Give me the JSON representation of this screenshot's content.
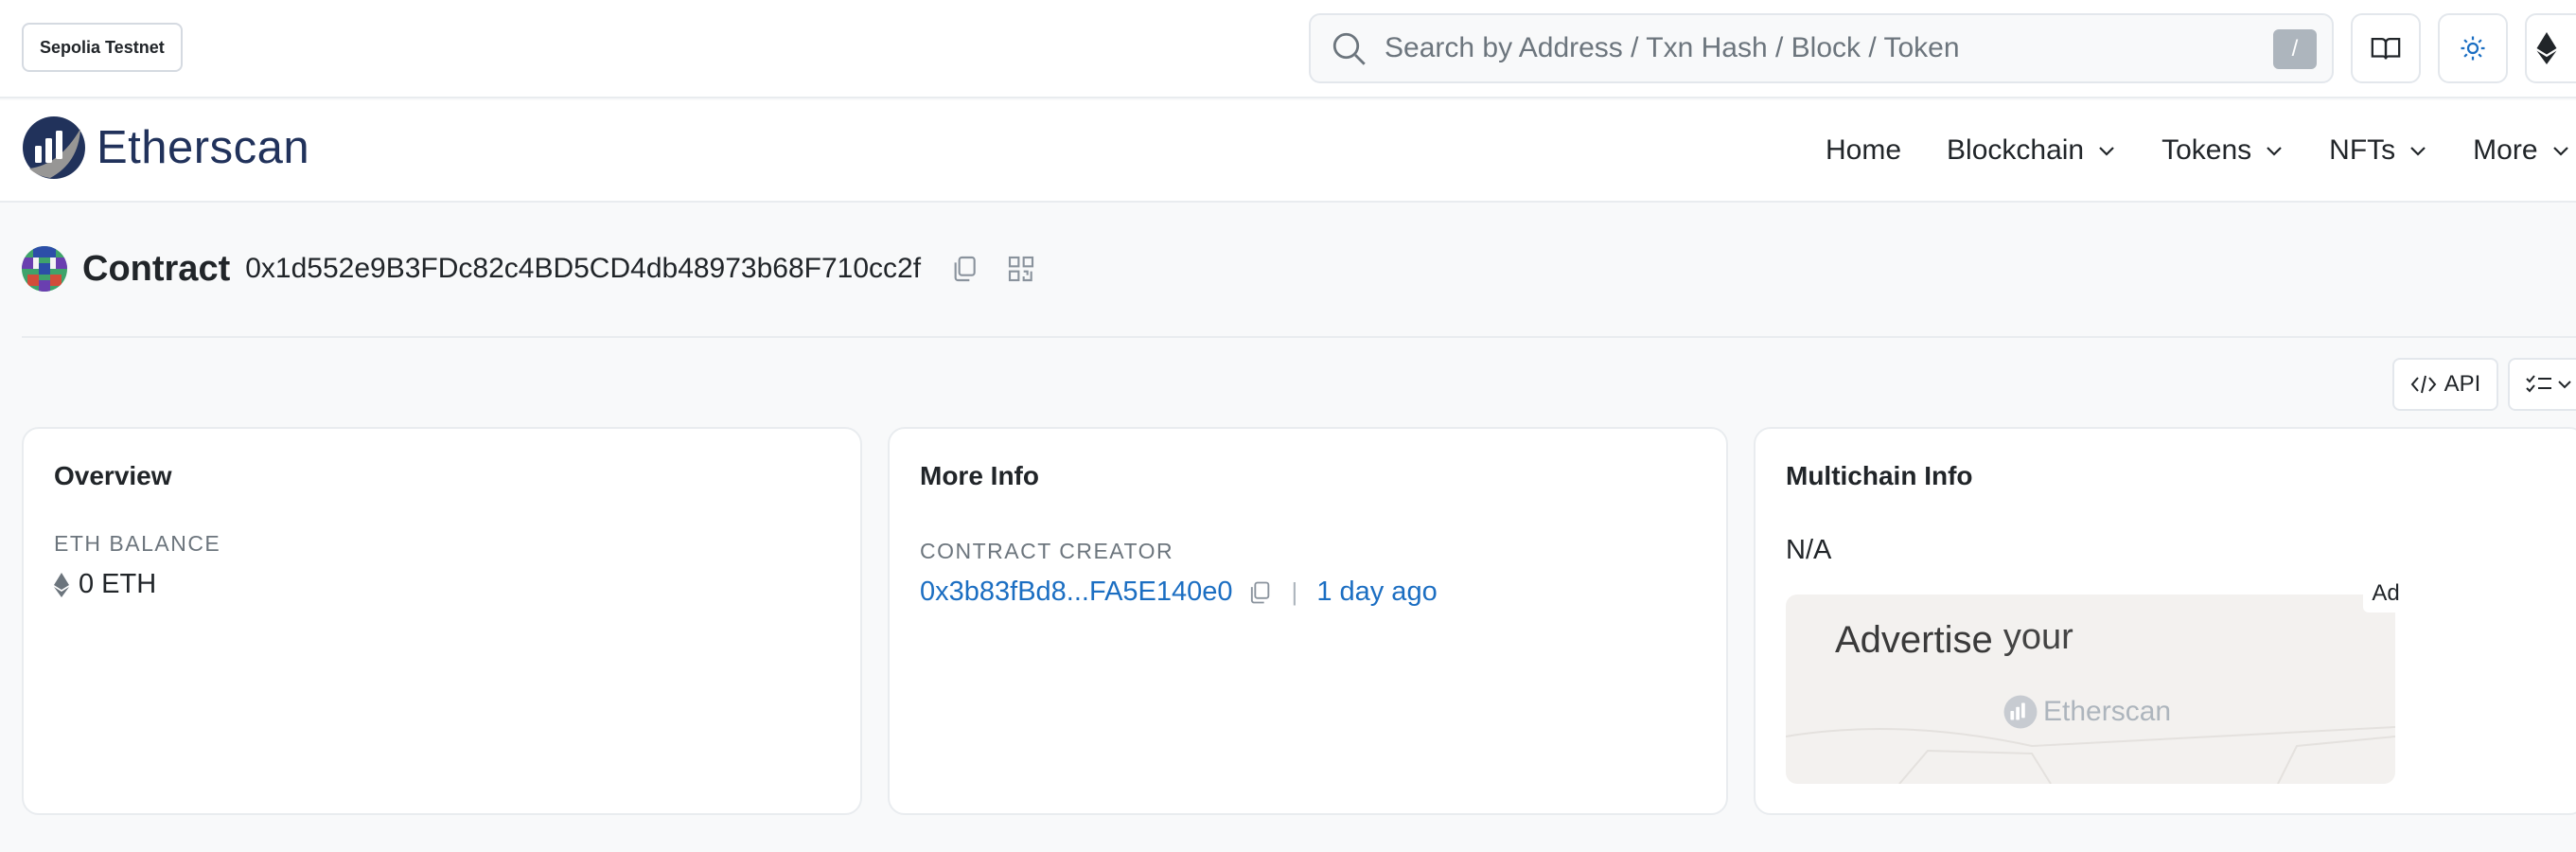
{
  "topbar": {
    "network_label": "Sepolia Testnet",
    "search": {
      "placeholder": "Search by Address / Txn Hash / Block / Token",
      "shortcut": "/"
    },
    "buttons": {
      "docs_icon": "book-icon",
      "theme_icon": "sun-icon",
      "network_icon": "ethereum-icon"
    }
  },
  "header": {
    "brand_name": "Etherscan",
    "nav": [
      {
        "label": "Home",
        "has_dropdown": false
      },
      {
        "label": "Blockchain",
        "has_dropdown": true
      },
      {
        "label": "Tokens",
        "has_dropdown": true
      },
      {
        "label": "NFTs",
        "has_dropdown": true
      },
      {
        "label": "More",
        "has_dropdown": true
      }
    ]
  },
  "contract": {
    "label": "Contract",
    "address": "0x1d552e9B3FDc82c4BD5CD4db48973b68F710cc2f",
    "actions": [
      "copy-icon",
      "qr-code-icon"
    ]
  },
  "tools": {
    "api_label": "API"
  },
  "cards": {
    "overview": {
      "title": "Overview",
      "balance_label": "ETH BALANCE",
      "balance_value": "0 ETH"
    },
    "more_info": {
      "title": "More Info",
      "creator_label": "CONTRACT CREATOR",
      "creator_address": "0x3b83fBd8...FA5E140e0",
      "separator": "|",
      "created_age": "1 day ago"
    },
    "multichain": {
      "title": "Multichain Info",
      "value": "N/A",
      "ad": {
        "headline_1": "Advertise",
        "headline_2": "your",
        "brand": "Etherscan",
        "badge": "Ad"
      }
    }
  },
  "colors": {
    "brand": "#21325b",
    "link": "#1b6ec2",
    "muted": "#6c757d",
    "background": "#f8f9fa"
  }
}
